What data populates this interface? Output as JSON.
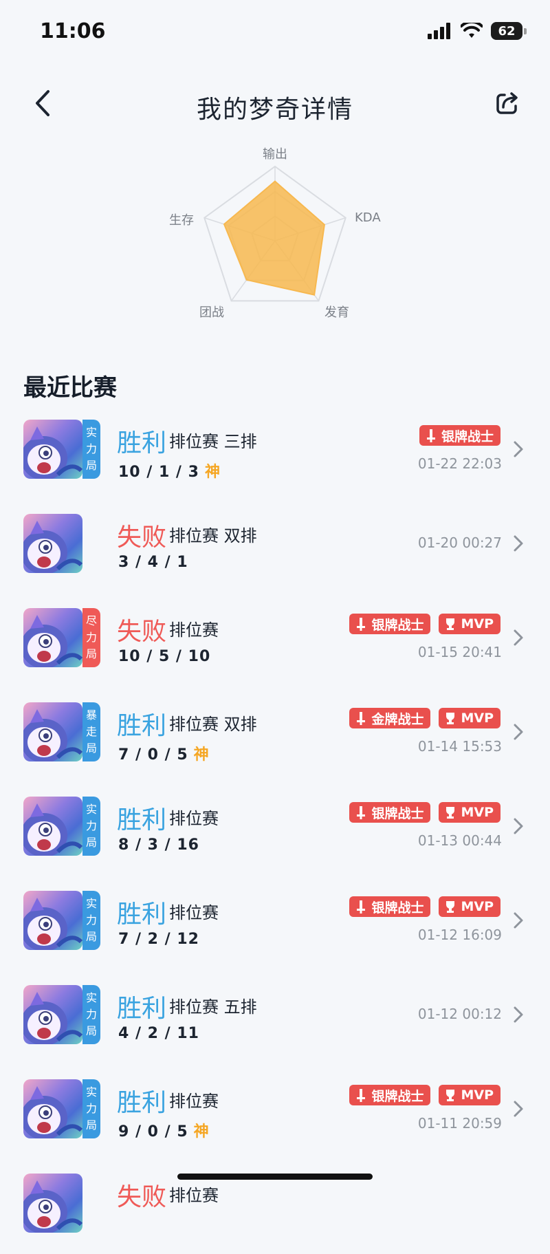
{
  "status": {
    "time": "11:06",
    "battery": "62"
  },
  "nav": {
    "title": "我的梦奇详情"
  },
  "radar": {
    "axes": [
      "输出",
      "KDA",
      "发育",
      "团战",
      "生存"
    ],
    "values": [
      0.8,
      0.7,
      0.9,
      0.65,
      0.72
    ]
  },
  "section": {
    "title": "最近比赛"
  },
  "matches": [
    {
      "result": "胜利",
      "mode": "排位赛 三排",
      "kda": "10 / 1 / 3",
      "god": "神",
      "tag": [
        "实",
        "力",
        "局"
      ],
      "tag_color": "#3a9ae0",
      "badges": [
        "银牌战士"
      ],
      "time": "01-22 22:03"
    },
    {
      "result": "失败",
      "mode": "排位赛 双排",
      "kda": "3 / 4 / 1",
      "god": "",
      "tag": [],
      "tag_color": "",
      "badges": [],
      "time": "01-20 00:27"
    },
    {
      "result": "失败",
      "mode": "排位赛",
      "kda": "10 / 5 / 10",
      "god": "",
      "tag": [
        "尽",
        "力",
        "局"
      ],
      "tag_color": "#ef5a57",
      "badges": [
        "银牌战士",
        "MVP"
      ],
      "time": "01-15 20:41"
    },
    {
      "result": "胜利",
      "mode": "排位赛 双排",
      "kda": "7 / 0 / 5",
      "god": "神",
      "tag": [
        "暴",
        "走",
        "局"
      ],
      "tag_color": "#3a9ae0",
      "badges": [
        "金牌战士",
        "MVP"
      ],
      "time": "01-14 15:53"
    },
    {
      "result": "胜利",
      "mode": "排位赛",
      "kda": "8 / 3 / 16",
      "god": "",
      "tag": [
        "实",
        "力",
        "局"
      ],
      "tag_color": "#3a9ae0",
      "badges": [
        "银牌战士",
        "MVP"
      ],
      "time": "01-13 00:44"
    },
    {
      "result": "胜利",
      "mode": "排位赛",
      "kda": "7 / 2 / 12",
      "god": "",
      "tag": [
        "实",
        "力",
        "局"
      ],
      "tag_color": "#3a9ae0",
      "badges": [
        "银牌战士",
        "MVP"
      ],
      "time": "01-12 16:09"
    },
    {
      "result": "胜利",
      "mode": "排位赛 五排",
      "kda": "4 / 2 / 11",
      "god": "",
      "tag": [
        "实",
        "力",
        "局"
      ],
      "tag_color": "#3a9ae0",
      "badges": [],
      "time": "01-12 00:12"
    },
    {
      "result": "胜利",
      "mode": "排位赛",
      "kda": "9 / 0 / 5",
      "god": "神",
      "tag": [
        "实",
        "力",
        "局"
      ],
      "tag_color": "#3a9ae0",
      "badges": [
        "银牌战士",
        "MVP"
      ],
      "time": "01-11 20:59"
    },
    {
      "result": "失败",
      "mode": "排位赛",
      "kda": "",
      "god": "",
      "tag": [],
      "tag_color": "",
      "badges": [],
      "time": ""
    }
  ],
  "colors": {
    "win": "#3aa3e0",
    "lose": "#ef5a57",
    "radar_fill": "#f7b84f",
    "badge": "#e9504d"
  }
}
